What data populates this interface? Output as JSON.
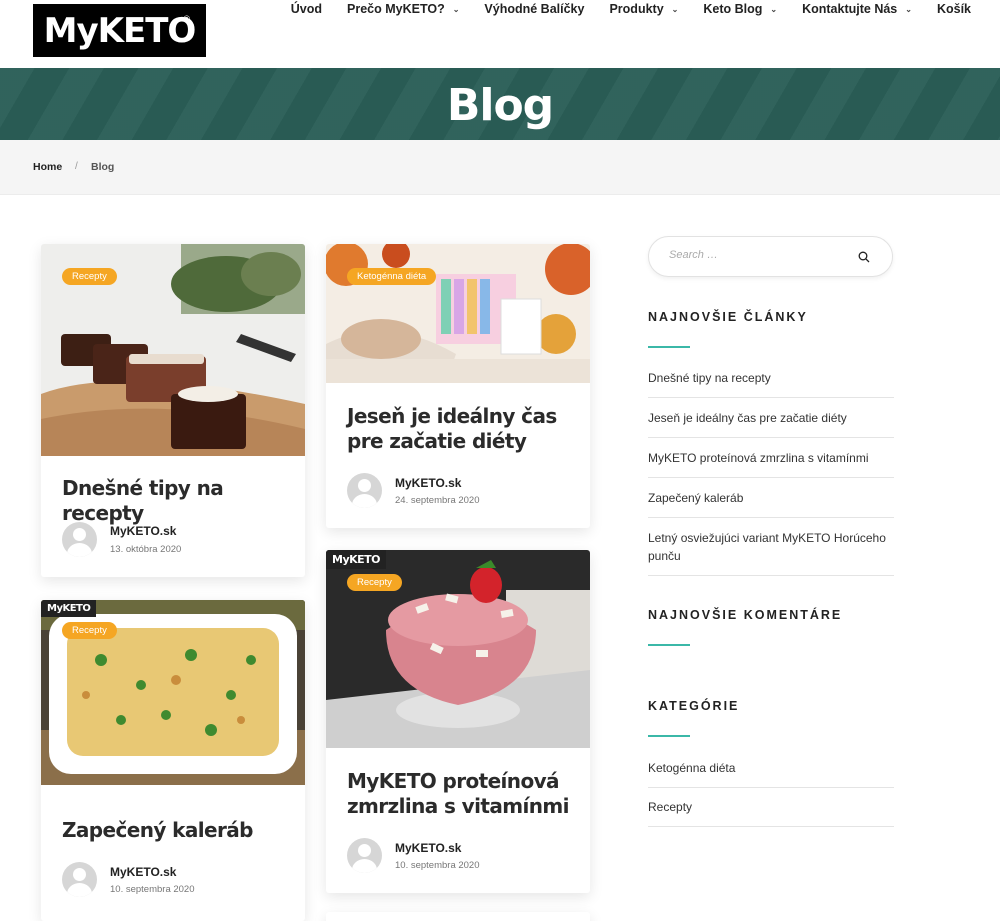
{
  "brand": {
    "logo": "MyKETO",
    "reg": "®"
  },
  "nav": [
    {
      "label": "Úvod",
      "dropdown": false
    },
    {
      "label": "Prečo MyKETO?",
      "dropdown": true
    },
    {
      "label": "Výhodné Balíčky",
      "dropdown": false
    },
    {
      "label": "Produkty",
      "dropdown": true
    },
    {
      "label": "Keto Blog",
      "dropdown": true
    },
    {
      "label": "Kontaktujte Nás",
      "dropdown": true
    },
    {
      "label": "Košík",
      "dropdown": false
    }
  ],
  "banner": {
    "title": "Blog"
  },
  "breadcrumb": {
    "home": "Home",
    "separator": "/",
    "current": "Blog"
  },
  "posts": [
    {
      "category": "Recepty",
      "title": "Dnešné tipy na recepty",
      "author": "MyKETO.sk",
      "date": "13. októbra 2020"
    },
    {
      "category": "Ketogénna diéta",
      "title": "Jeseň je ideálny čas pre začatie diéty",
      "author": "MyKETO.sk",
      "date": "24. septembra 2020"
    },
    {
      "category": "Recepty",
      "title": "Zapečený kaleráb",
      "author": "MyKETO.sk",
      "date": "10. septembra 2020",
      "image_brand": "MyKETO"
    },
    {
      "category": "Recepty",
      "title": "MyKETO proteínová zmrzlina s vitamínmi",
      "author": "MyKETO.sk",
      "date": "10. septembra 2020",
      "image_brand": "MyKETO"
    }
  ],
  "sidebar": {
    "search_placeholder": "Search …",
    "recent_title": "NAJNOVŠIE ČLÁNKY",
    "recent": [
      "Dnešné tipy na recepty",
      "Jeseň je ideálny čas pre začatie diéty",
      "MyKETO proteínová zmrzlina s vitamínmi",
      "Zapečený kaleráb",
      "Letný osviežujúci variant MyKETO Horúceho punču"
    ],
    "comments_title": "NAJNOVŠIE KOMENTÁRE",
    "categories_title": "KATEGÓRIE",
    "categories": [
      "Ketogénna diéta",
      "Recepty"
    ]
  },
  "colors": {
    "banner": "#2a5e57",
    "accent": "#3bb8a8",
    "badge": "#f5a623"
  }
}
